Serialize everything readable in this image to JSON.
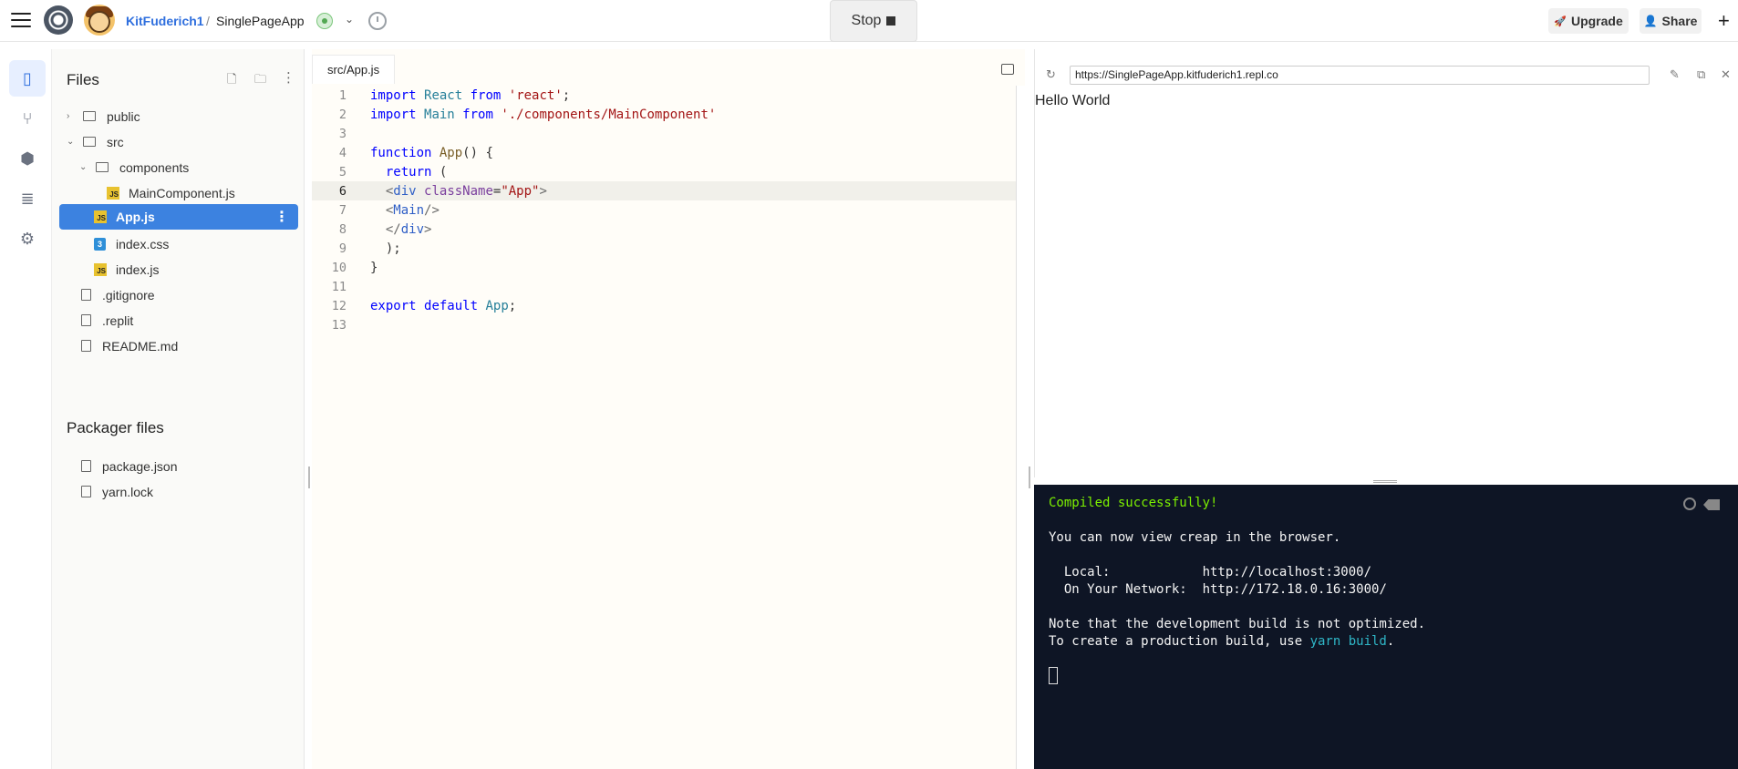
{
  "topbar": {
    "user": "KitFuderich1",
    "separator": "/",
    "project": "SinglePageApp",
    "stop_label": "Stop",
    "upgrade_label": "Upgrade",
    "share_label": "Share"
  },
  "files": {
    "title": "Files",
    "items": [
      {
        "label": "public"
      },
      {
        "label": "src"
      },
      {
        "label": "components"
      },
      {
        "label": "MainComponent.js"
      },
      {
        "label": "App.js"
      },
      {
        "label": "index.css"
      },
      {
        "label": "index.js"
      },
      {
        "label": ".gitignore"
      },
      {
        "label": ".replit"
      },
      {
        "label": "README.md"
      }
    ],
    "packager_title": "Packager files",
    "packager_items": [
      {
        "label": "package.json"
      },
      {
        "label": "yarn.lock"
      }
    ]
  },
  "editor": {
    "tab": "src/App.js",
    "line_numbers": [
      "1",
      "2",
      "3",
      "4",
      "5",
      "6",
      "7",
      "8",
      "9",
      "10",
      "11",
      "12",
      "13"
    ],
    "current_line": 6
  },
  "preview": {
    "url": "https://SinglePageApp.kitfuderich1.repl.co",
    "content": "Hello World"
  },
  "terminal": {
    "line1": "Compiled successfully!",
    "line2": "You can now view creap in the browser.",
    "local_label": "  Local:            ",
    "local_url": "http://localhost:3000/",
    "network_label": "  On Your Network:  ",
    "network_url": "http://172.18.0.16:3000/",
    "note1": "Note that the development build is not optimized.",
    "note2_prefix": "To create a production build, use ",
    "note2_cmd": "yarn build",
    "note2_suffix": "."
  },
  "colors": {
    "accent": "#3c82e0",
    "terminal_bg": "#0e1525",
    "success": "#7cf000"
  }
}
